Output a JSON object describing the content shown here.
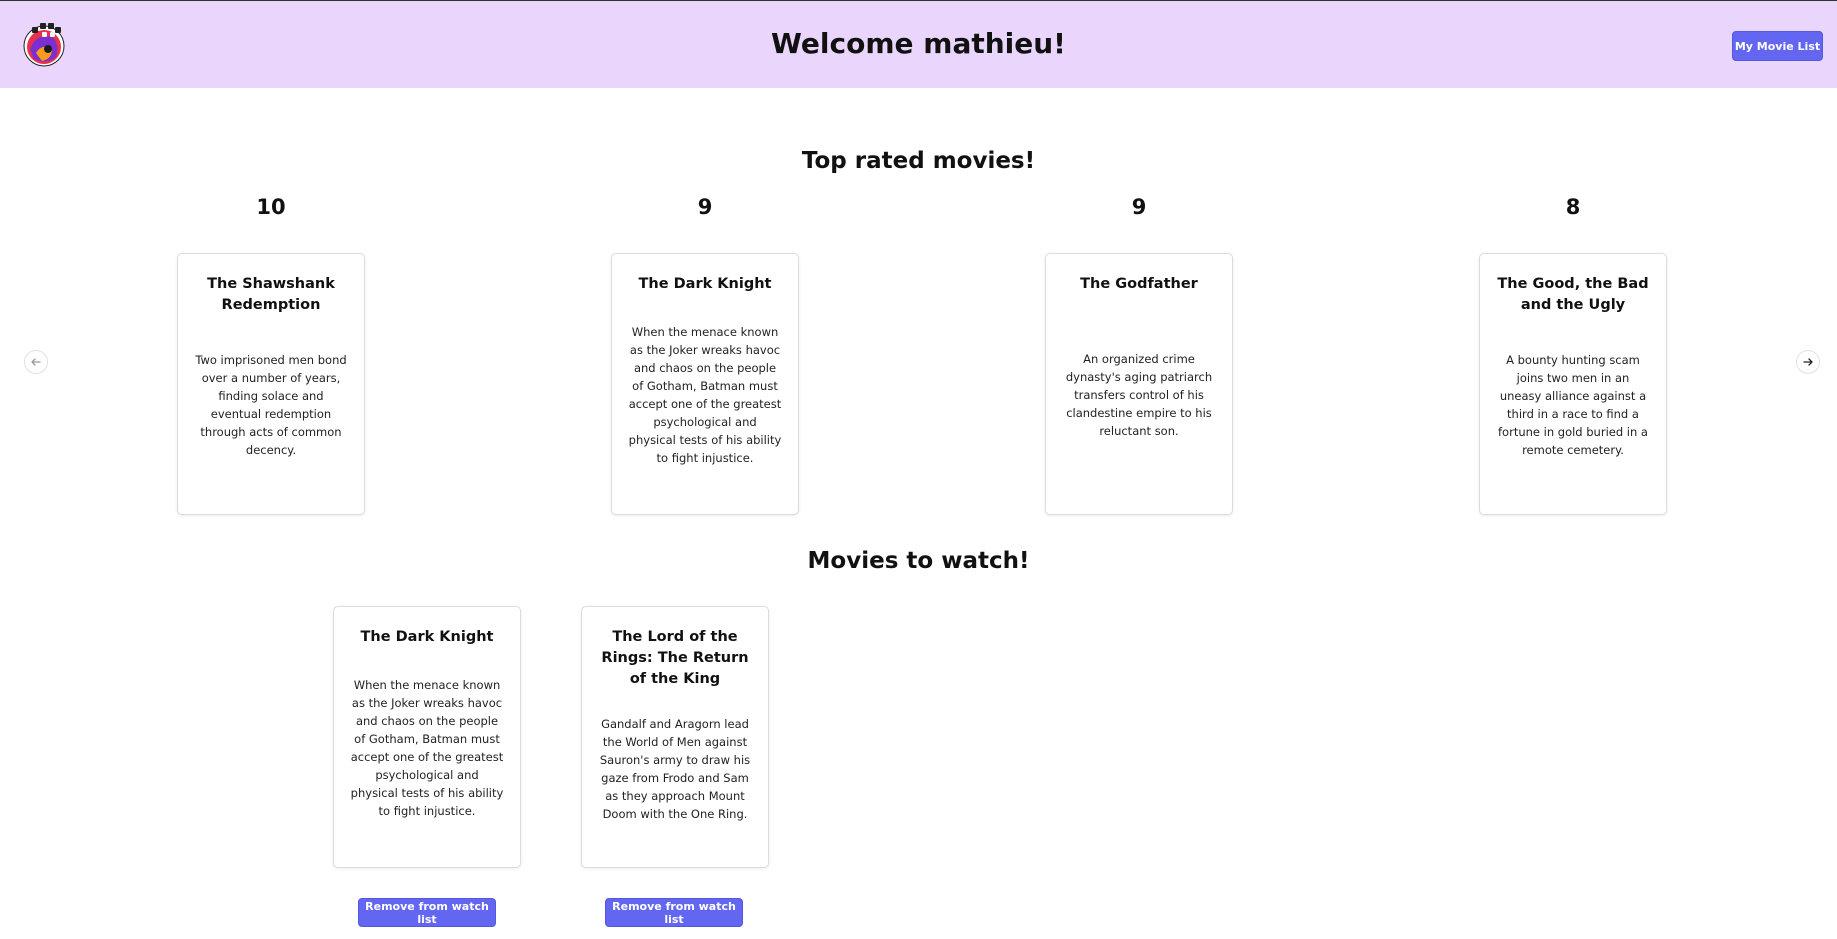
{
  "header": {
    "welcome": "Welcome mathieu!",
    "my_movie_list_label": "My Movie List"
  },
  "top_rated": {
    "title": "Top rated movies!",
    "movies": [
      {
        "rating": "10",
        "title": "The Shawshank Redemption",
        "description": "Two imprisoned men bond over a number of years, finding solace and eventual redemption through acts of common decency."
      },
      {
        "rating": "9",
        "title": "The Dark Knight",
        "description": "When the menace known as the Joker wreaks havoc and chaos on the people of Gotham, Batman must accept one of the greatest psychological and physical tests of his ability to fight injustice."
      },
      {
        "rating": "9",
        "title": "The Godfather",
        "description": "An organized crime dynasty's aging patriarch transfers control of his clandestine empire to his reluctant son."
      },
      {
        "rating": "8",
        "title": "The Good, the Bad and the Ugly",
        "description": "A bounty hunting scam joins two men in an uneasy alliance against a third in a race to find a fortune in gold buried in a remote cemetery."
      }
    ]
  },
  "watch_list": {
    "title": "Movies to watch!",
    "movies": [
      {
        "title": "The Dark Knight",
        "description": "When the menace known as the Joker wreaks havoc and chaos on the people of Gotham, Batman must accept one of the greatest psychological and physical tests of his ability to fight injustice.",
        "remove_label": "Remove from watch list"
      },
      {
        "title": "The Lord of the Rings: The Return of the King",
        "description": "Gandalf and Aragorn lead the World of Men against Sauron's army to draw his gaze from Frodo and Sam as they approach Mount Doom with the One Ring.",
        "remove_label": "Remove from watch list"
      }
    ]
  },
  "icons": {
    "logo": "film-reel-logo",
    "prev": "arrow-left-icon",
    "next": "arrow-right-icon"
  },
  "colors": {
    "header_bg": "#ead6fd",
    "accent": "#6366f1"
  }
}
